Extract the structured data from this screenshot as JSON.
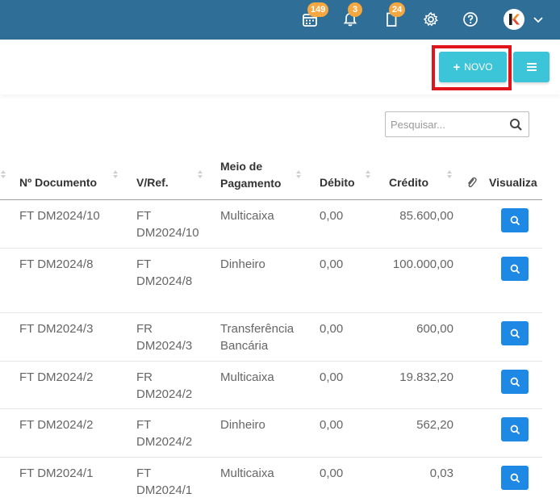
{
  "topbar": {
    "calendar_count": "149",
    "notifications_count": "3",
    "documents_count": "24",
    "avatar_letter": "K"
  },
  "actions": {
    "novo_label": "NOVO",
    "plus_symbol": "+"
  },
  "search": {
    "placeholder": "Pesquisar..."
  },
  "table": {
    "headers": {
      "documento": "Nº Documento",
      "vref": "V/Ref.",
      "meio_line1": "Meio de",
      "meio_line2": "Pagamento",
      "debito": "Débito",
      "credito": "Crédito",
      "visualizar": "Visualiza"
    },
    "rows": [
      {
        "documento": "FT DM2024/10",
        "vref1": "FT",
        "vref2": "DM2024/10",
        "meio1": "Multicaixa",
        "meio2": "",
        "debito": "0,00",
        "credito": "85.600,00"
      },
      {
        "documento": "FT DM2024/8",
        "vref1": "FT",
        "vref2": "DM2024/8",
        "meio1": "Dinheiro",
        "meio2": "",
        "debito": "0,00",
        "credito": "100.000,00"
      },
      {
        "documento": "FT DM2024/3",
        "vref1": "FR",
        "vref2": "DM2024/3",
        "meio1": "Transferência",
        "meio2": "Bancária",
        "debito": "0,00",
        "credito": "600,00"
      },
      {
        "documento": "FT DM2024/2",
        "vref1": "FR",
        "vref2": "DM2024/2",
        "meio1": "Multicaixa",
        "meio2": "",
        "debito": "0,00",
        "credito": "19.832,20"
      },
      {
        "documento": "FT DM2024/2",
        "vref1": "FT",
        "vref2": "DM2024/2",
        "meio1": "Dinheiro",
        "meio2": "",
        "debito": "0,00",
        "credito": "562,20"
      },
      {
        "documento": "FT DM2024/1",
        "vref1": "FT",
        "vref2": "DM2024/1",
        "meio1": "Multicaixa",
        "meio2": "",
        "debito": "0,00",
        "credito": "0,03"
      }
    ]
  },
  "colors": {
    "topbar": "#2f6e96",
    "accent_button": "#3cc4d9",
    "view_button": "#1e88e5",
    "badge": "#f5a742",
    "highlight": "#e0141b"
  },
  "icons": [
    "calendar-icon",
    "bell-icon",
    "document-icon",
    "gear-icon",
    "help-icon",
    "chevron-down-icon",
    "plus-icon",
    "menu-icon",
    "search-icon",
    "paperclip-icon",
    "sort-icon"
  ]
}
